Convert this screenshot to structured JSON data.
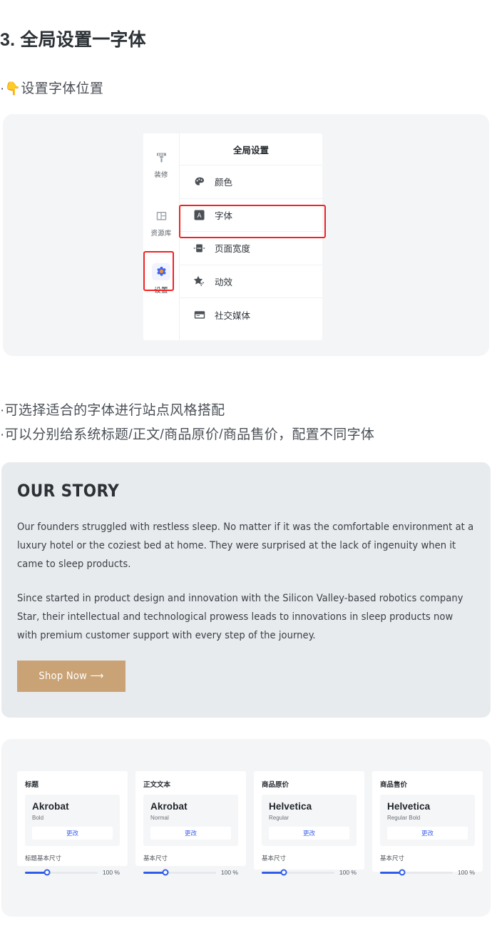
{
  "heading": "3. 全局设置一字体",
  "bullets": {
    "b1_prefix": "·",
    "b1_emoji": "👇",
    "b1_text": "设置字体位置",
    "b2": "·可选择适合的字体进行站点风格搭配",
    "b3": "·可以分别给系统标题/正文/商品原价/商品售价，配置不同字体"
  },
  "editor": {
    "rail": [
      {
        "label": "装修",
        "icon": "paint-brush-icon",
        "active": false
      },
      {
        "label": "资源库",
        "icon": "library-grid-icon",
        "active": false
      },
      {
        "label": "设置",
        "icon": "gear-icon",
        "active": true
      }
    ],
    "panel_title": "全局设置",
    "rows": [
      {
        "label": "颜色",
        "icon": "palette-icon",
        "highlighted": false
      },
      {
        "label": "字体",
        "icon": "font-a-icon",
        "highlighted": true
      },
      {
        "label": "页面宽度",
        "icon": "page-width-icon",
        "highlighted": false
      },
      {
        "label": "动效",
        "icon": "star-sparkle-icon",
        "highlighted": false
      },
      {
        "label": "社交媒体",
        "icon": "social-media-icon",
        "highlighted": false
      }
    ],
    "annotation_color": "#f42121"
  },
  "story": {
    "title": "OUR STORY",
    "paragraph1": "Our founders struggled with restless sleep. No matter if it was the comfortable environment at a luxury hotel or the coziest bed at home. They were surprised at the lack of ingenuity when it came to sleep products.",
    "paragraph2": "Since started in product design and innovation with the Silicon Valley-based robotics company Star, their intellectual and technological prowess leads to innovations in sleep products now with premium customer support with every step of the journey.",
    "button_label": "Shop Now ⟶",
    "button_color": "#c9a376",
    "background_color": "#e8ebee"
  },
  "font_cards": [
    {
      "label": "标题",
      "font_name": "Akrobat",
      "weight": "Bold",
      "change_label": "更改",
      "size_label": "标题基本尺寸",
      "size_value": "100 %",
      "slider_percent": 30
    },
    {
      "label": "正文文本",
      "font_name": "Akrobat",
      "weight": "Normal",
      "change_label": "更改",
      "size_label": "基本尺寸",
      "size_value": "100 %",
      "slider_percent": 30
    },
    {
      "label": "商品原价",
      "font_name": "Helvetica",
      "weight": "Regular",
      "change_label": "更改",
      "size_label": "基本尺寸",
      "size_value": "100 %",
      "slider_percent": 30
    },
    {
      "label": "商品售价",
      "font_name": "Helvetica",
      "weight": "Regular Bold",
      "change_label": "更改",
      "size_label": "基本尺寸",
      "size_value": "100 %",
      "slider_percent": 30
    }
  ],
  "colors": {
    "accent_blue": "#2f5ce8",
    "panel_gray": "#f4f5f7",
    "annotation_red": "#f42121"
  }
}
